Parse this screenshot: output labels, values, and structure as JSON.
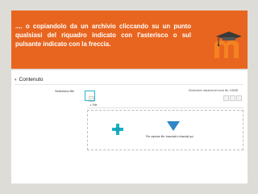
{
  "banner": {
    "text": ".... o copiandolo da un archivio cliccando su un punto qualsiasi del riquadro indicato con l'asterisco o sul pulsante indicato con la freccia."
  },
  "colors": {
    "banner_bg": "#e8651f",
    "logo_orange": "#f58220",
    "highlight": "#28b6c8",
    "plus": "#1ab0c4",
    "arrow": "#2f86c8"
  },
  "section": {
    "caret": "▾",
    "title": "Contenuto"
  },
  "file_picker": {
    "label": "Seleziona file",
    "max_size": "Dimensione massima dei nuovi file: 100MB",
    "folder_caret": "▸",
    "folder_name": "File",
    "drop_text": "Per caricare file, trascinali e rilasciali qui."
  }
}
